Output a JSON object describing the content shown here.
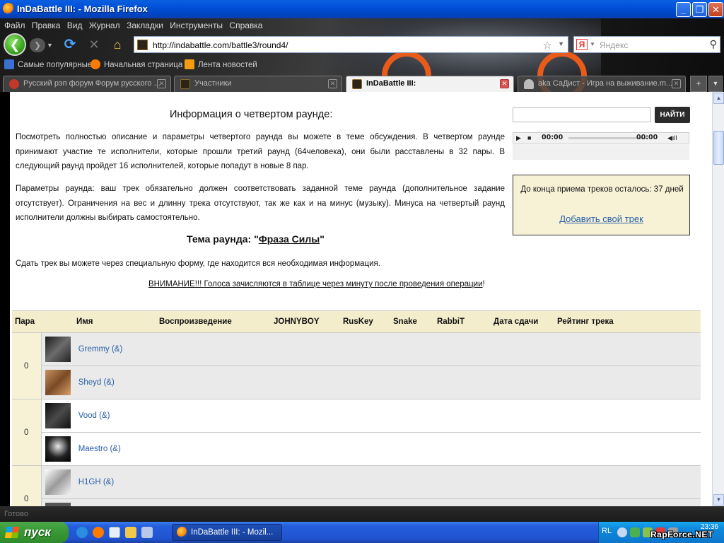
{
  "window": {
    "title": "InDaBattle III: - Mozilla Firefox"
  },
  "menu": [
    "Файл",
    "Правка",
    "Вид",
    "Журнал",
    "Закладки",
    "Инструменты",
    "Справка"
  ],
  "nav": {
    "url": "http://indabattle.com/battle3/round4/",
    "search_placeholder": "Яндекс",
    "search_engine_letter": "Я"
  },
  "bookmarks": [
    {
      "label": "Самые популярные",
      "icon": "bookmark-star-icon",
      "color": "#3b6fd1"
    },
    {
      "label": "Начальная страница",
      "icon": "firefox-icon",
      "color": "#ff7b00"
    },
    {
      "label": "Лента новостей",
      "icon": "rss-icon",
      "color": "#f39c12"
    }
  ],
  "tabs": [
    {
      "label": "Русский рэп форум Форум русского ...",
      "icon_color": "#c0392b",
      "active": false
    },
    {
      "label": "Участники",
      "icon_color": "#2c2417",
      "active": false
    },
    {
      "label": "InDaBattle III:",
      "icon_color": "#2c2417",
      "active": true
    },
    {
      "label": "aka СаДист - Игра на выживание.m...",
      "icon_color": "#bbbbbb",
      "active": false
    }
  ],
  "page": {
    "info_title": "Информация о четвертом раунде:",
    "para1": "Посмотреть полностью описание и параметры четвертого раунда вы можете в теме обсуждения. В четвертом раунде принимают участие те исполнители, которые прошли третий раунд (64человека), они были расставлены в 32 пары. В следующий раунд пройдет 16 исполнителей, которые попадут в новые 8 пар.",
    "para2": "Параметры раунда: ваш трек обязательно должен соответствовать заданной теме раунда (дополнительное задание отсутствует). Ограничения на вес и длинну трека отсутствуют, так же как и на минус (музыку). Минуса на четвертый раунд исполнители должны выбирать самостоятельно.",
    "theme_prefix": "Тема раунда: \"",
    "theme_link": "Фраза Силы",
    "theme_suffix": "\"",
    "submit_text": "Сдать трек вы можете через специальную форму, где находится вся необходимая информация.",
    "warning_link": "ВНИМАНИЕ!!! Голоса зачисляются в таблице через минуту после проведения операции",
    "warning_tail": "!",
    "search_button": "НАЙТИ",
    "player": {
      "time_current": "00:00",
      "time_total": "00:00"
    },
    "remaining": "До конца приема треков осталось: 37 дней",
    "add_track": "Добавить свой трек"
  },
  "table": {
    "headers": [
      "Пара",
      "Имя",
      "Воспроизведение",
      "JOHNYBOY",
      "RusKey",
      "Snake",
      "RabbiT",
      "Дата сдачи",
      "Рейтинг трека"
    ],
    "pairs": [
      {
        "score": "0",
        "players": [
          "Gremmy (&)",
          "Sheyd (&)"
        ]
      },
      {
        "score": "0",
        "players": [
          "Vood (&)",
          "Maestro (&)"
        ]
      },
      {
        "score": "0",
        "players": [
          "H1GH (&)"
        ]
      }
    ]
  },
  "status": "Готово",
  "taskbar": {
    "start": "пуск",
    "task": "InDaBattle III: - Mozil...",
    "lang": "RL",
    "clock": "23:36"
  },
  "watermark": "RapForce.NET"
}
